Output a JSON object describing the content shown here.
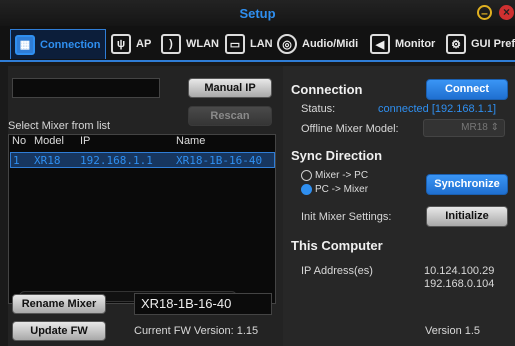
{
  "window": {
    "title": "Setup"
  },
  "tabs": [
    {
      "label": "Connection",
      "icon": "mixer-icon",
      "active": true
    },
    {
      "label": "AP",
      "icon": "antenna-icon"
    },
    {
      "label": "WLAN",
      "icon": "wifi-icon"
    },
    {
      "label": "LAN",
      "icon": "ethernet-icon"
    },
    {
      "label": "Audio/Midi",
      "icon": "midi-icon"
    },
    {
      "label": "Monitor",
      "icon": "speaker-icon"
    },
    {
      "label": "GUI Prefs",
      "icon": "gears-icon"
    }
  ],
  "left": {
    "manual_ip_value": "",
    "manual_ip_button": "Manual IP",
    "rescan_button": "Rescan",
    "select_label": "Select Mixer from list",
    "columns": [
      "No",
      "Model",
      "IP",
      "Name"
    ],
    "rows": [
      {
        "no": "1",
        "model": "XR18",
        "ip": "192.168.1.1",
        "name": "XR18-1B-16-40"
      }
    ],
    "rename_button": "Rename Mixer",
    "rename_value": "XR18-1B-16-40",
    "update_button": "Update FW",
    "fw_version": "Current FW Version: 1.15"
  },
  "right": {
    "connection_heading": "Connection",
    "connect_button": "Connect",
    "status_label": "Status:",
    "status_value": "connected [192.168.1.1]",
    "offline_label": "Offline Mixer Model:",
    "offline_value": "MR18",
    "sync_heading": "Sync Direction",
    "radio_mixer_to_pc": "Mixer -> PC",
    "radio_pc_to_mixer": "PC -> Mixer",
    "synchronize_button": "Synchronize",
    "init_label": "Init Mixer Settings:",
    "initialize_button": "Initialize",
    "computer_heading": "This Computer",
    "ip_label": "IP Address(es)",
    "ip_1": "10.124.100.29",
    "ip_2": "192.168.0.104",
    "version": "Version 1.5"
  },
  "colors": {
    "accent": "#2f8ff0",
    "background": "#1a1a1a"
  }
}
